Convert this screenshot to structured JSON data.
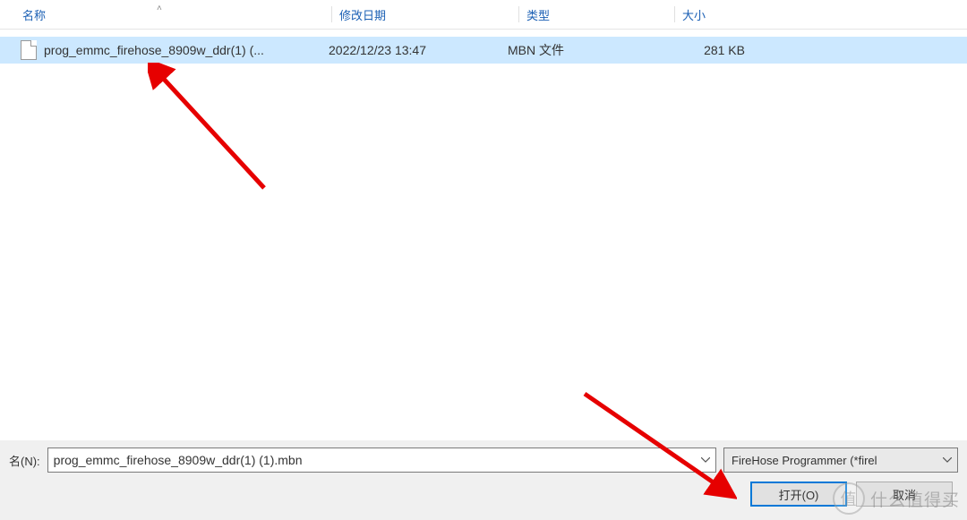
{
  "columns": {
    "name": "名称",
    "date": "修改日期",
    "type": "类型",
    "size": "大小"
  },
  "files": [
    {
      "name": "prog_emmc_firehose_8909w_ddr(1) (...",
      "date": "2022/12/23 13:47",
      "type": "MBN 文件",
      "size": "281 KB"
    }
  ],
  "filename_label": "名(N):",
  "filename_value": "prog_emmc_firehose_8909w_ddr(1) (1).mbn",
  "filetype_value": "FireHose Programmer (*firel",
  "open_button": "打开(O)",
  "cancel_button": "取消",
  "watermark_text": "什么值得买",
  "watermark_badge": "值"
}
